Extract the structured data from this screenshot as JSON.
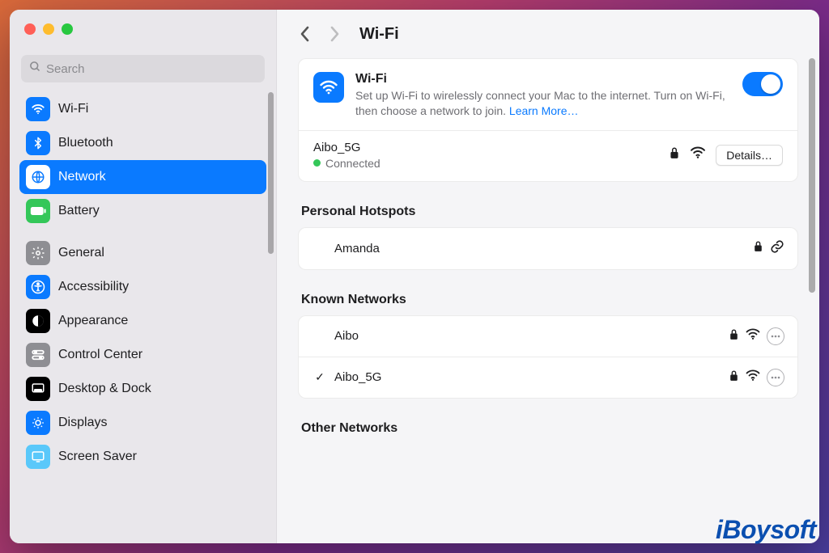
{
  "window": {
    "title": "Wi-Fi"
  },
  "search": {
    "placeholder": "Search"
  },
  "sidebar": {
    "items": [
      {
        "label": "Wi-Fi"
      },
      {
        "label": "Bluetooth"
      },
      {
        "label": "Network"
      },
      {
        "label": "Battery"
      },
      {
        "label": "General"
      },
      {
        "label": "Accessibility"
      },
      {
        "label": "Appearance"
      },
      {
        "label": "Control Center"
      },
      {
        "label": "Desktop & Dock"
      },
      {
        "label": "Displays"
      },
      {
        "label": "Screen Saver"
      }
    ],
    "active_index": 2
  },
  "wifi_card": {
    "heading": "Wi-Fi",
    "description": "Set up Wi-Fi to wirelessly connect your Mac to the internet. Turn on Wi-Fi, then choose a network to join. ",
    "learn_more": "Learn More…",
    "toggle_on": true,
    "current_network": "Aibo_5G",
    "status": "Connected",
    "details_label": "Details…"
  },
  "sections": {
    "hotspots": {
      "title": "Personal Hotspots",
      "items": [
        {
          "name": "Amanda",
          "locked": true,
          "link": true
        }
      ]
    },
    "known": {
      "title": "Known Networks",
      "items": [
        {
          "name": "Aibo",
          "checked": false,
          "locked": true,
          "wifi": true,
          "more": true
        },
        {
          "name": "Aibo_5G",
          "checked": true,
          "locked": true,
          "wifi": true,
          "more": true
        }
      ]
    },
    "other": {
      "title": "Other Networks"
    }
  },
  "watermark": "iBoysoft"
}
